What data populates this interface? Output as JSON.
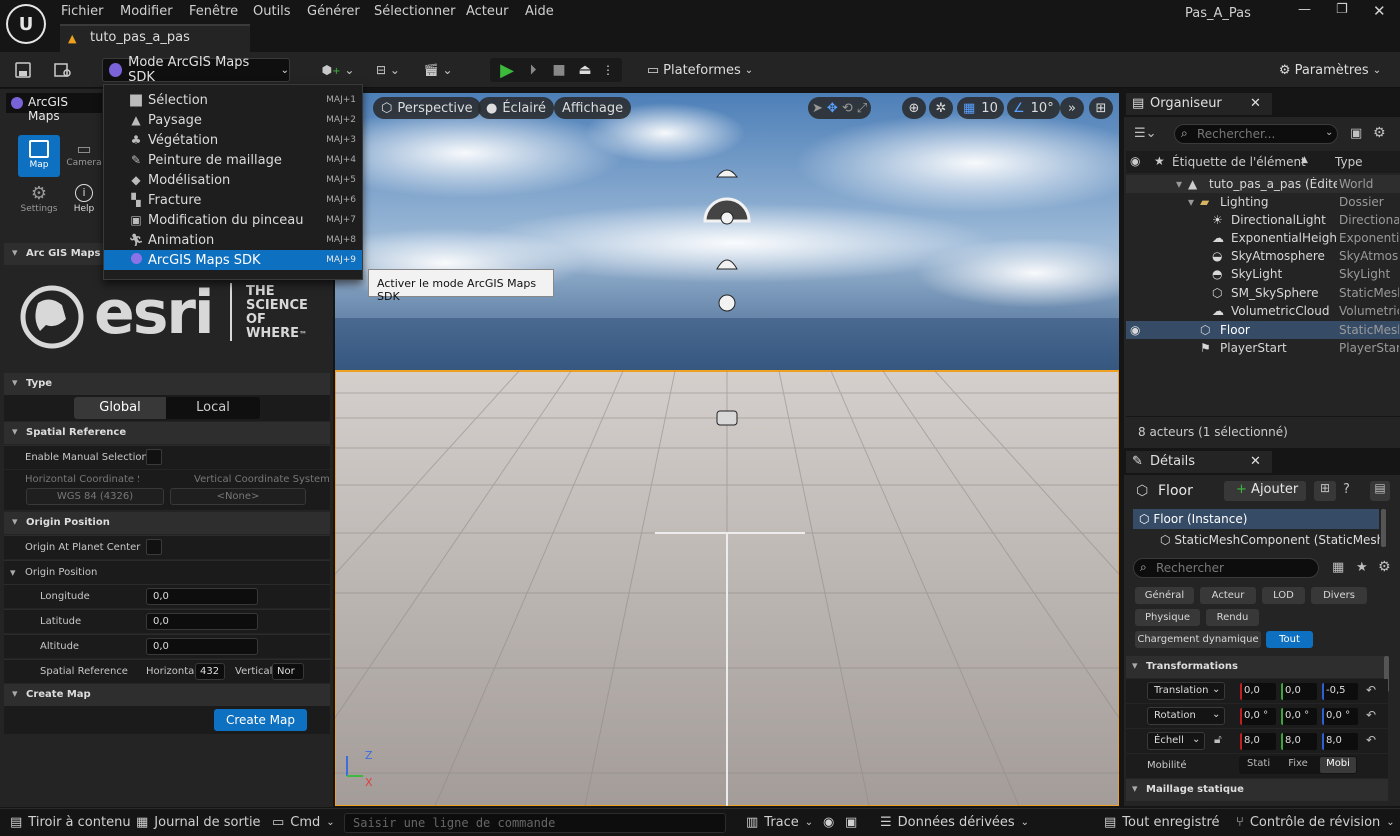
{
  "menubar": {
    "items": [
      "Fichier",
      "Modifier",
      "Fenêtre",
      "Outils",
      "Générer",
      "Sélectionner",
      "Acteur",
      "Aide"
    ],
    "project_name": "Pas_A_Pas"
  },
  "tab": {
    "label": "tuto_pas_a_pas"
  },
  "toolbar": {
    "mode_label": "Mode ArcGIS Maps SDK",
    "platforms_label": "Plateformes",
    "settings_label": "Paramètres"
  },
  "mode_menu": {
    "items": [
      {
        "label": "Sélection",
        "shortcut": "MAJ+1",
        "icon": "select-icon"
      },
      {
        "label": "Paysage",
        "shortcut": "MAJ+2",
        "icon": "landscape-icon"
      },
      {
        "label": "Végétation",
        "shortcut": "MAJ+3",
        "icon": "foliage-icon"
      },
      {
        "label": "Peinture de maillage",
        "shortcut": "MAJ+4",
        "icon": "mesh-paint-icon"
      },
      {
        "label": "Modélisation",
        "shortcut": "MAJ+5",
        "icon": "modeling-icon"
      },
      {
        "label": "Fracture",
        "shortcut": "MAJ+6",
        "icon": "fracture-icon"
      },
      {
        "label": "Modification du pinceau",
        "shortcut": "MAJ+7",
        "icon": "brush-icon"
      },
      {
        "label": "Animation",
        "shortcut": "MAJ+8",
        "icon": "animation-icon"
      },
      {
        "label": "ArcGIS Maps SDK",
        "shortcut": "MAJ+9",
        "icon": "arcgis-icon"
      }
    ],
    "selected_index": 8,
    "tooltip": "Activer le mode ArcGIS Maps SDK"
  },
  "left_panel": {
    "title": "ArcGIS Maps",
    "tools": [
      {
        "label": "Map",
        "icon": "map-icon"
      },
      {
        "label": "Camera",
        "icon": "camera-icon"
      },
      {
        "label": "Settings",
        "icon": "gear-icon"
      },
      {
        "label": "Help",
        "icon": "info-icon"
      }
    ],
    "section_title": "Arc GIS Maps SDK",
    "logo": {
      "word": "esri",
      "tagline_1": "THE",
      "tagline_2": "SCIENCE",
      "tagline_3": "OF",
      "tagline_4": "WHERE",
      "tm": "™"
    },
    "type_header": "Type",
    "type_options": [
      "Global",
      "Local"
    ],
    "type_selected": "Global",
    "spatial_reference_header": "Spatial Reference",
    "enable_manual_selection": "Enable Manual Selection",
    "horizontal_cs_label": "Horizontal Coordinate Syste",
    "vertical_cs_label": "Vertical Coordinate System",
    "horizontal_cs_value": "WGS 84 (4326)",
    "vertical_cs_value": "<None>",
    "origin_position_header": "Origin Position",
    "origin_at_planet_center": "Origin At Planet Center",
    "origin_position_sub": "Origin Position",
    "longitude_label": "Longitude",
    "longitude_value": "0,0",
    "latitude_label": "Latitude",
    "latitude_value": "0,0",
    "altitude_label": "Altitude",
    "altitude_value": "0,0",
    "spatial_ref_label": "Spatial Reference",
    "horizontal_label": "Horizontal",
    "horizontal_value": "432",
    "vertical_label": "Vertical",
    "vertical_value": "Nor",
    "create_map_header": "Create Map",
    "create_map_button": "Create Map"
  },
  "viewport": {
    "perspective": "Perspective",
    "lighting": "Éclairé",
    "show": "Affichage",
    "grid_snap": "10",
    "rot_snap": "10°",
    "axis_z": "Z",
    "axis_x": "X"
  },
  "outliner": {
    "tab": "Organiseur",
    "search_placeholder": "Rechercher...",
    "col_label": "Étiquette de l'élément",
    "col_type": "Type",
    "rows": [
      {
        "name": "tuto_pas_a_pas (Édite",
        "type": "World"
      },
      {
        "name": "Lighting",
        "type": "Dossier"
      },
      {
        "name": "DirectionalLight",
        "type": "Directiona"
      },
      {
        "name": "ExponentialHeight",
        "type": "Exponentia"
      },
      {
        "name": "SkyAtmosphere",
        "type": "SkyAtmos"
      },
      {
        "name": "SkyLight",
        "type": "SkyLight"
      },
      {
        "name": "SM_SkySphere",
        "type": "StaticMesh"
      },
      {
        "name": "VolumetricCloud",
        "type": "Volumetric"
      },
      {
        "name": "Floor",
        "type": "StaticMesh"
      },
      {
        "name": "PlayerStart",
        "type": "PlayerStar"
      }
    ],
    "status": "8 acteurs (1 sélectionné)"
  },
  "details": {
    "tab": "Détails",
    "object_name": "Floor",
    "add_button": "Ajouter",
    "instance": "Floor (Instance)",
    "component": "StaticMeshComponent (StaticMesh",
    "search_placeholder": "Rechercher",
    "categories": [
      "Général",
      "Acteur",
      "LOD",
      "Divers",
      "Physique",
      "Rendu",
      "Chargement dynamique",
      "Tout"
    ],
    "active_category": "Tout",
    "transforms_header": "Transformations",
    "translation_label": "Translation",
    "translation": [
      "0,0",
      "0,0",
      "-0,5"
    ],
    "rotation_label": "Rotation",
    "rotation": [
      "0,0 °",
      "0,0 °",
      "0,0 °"
    ],
    "scale_label": "Échell",
    "scale": [
      "8,0",
      "8,0",
      "8,0"
    ],
    "mobility_label": "Mobilité",
    "mobility_options": [
      "Stati",
      "Fixe",
      "Mobi"
    ],
    "mobility_selected": "Mobi",
    "static_mesh_header": "Maillage statique"
  },
  "statusbar": {
    "content_drawer": "Tiroir à contenu",
    "output_log": "Journal de sortie",
    "cmd": "Cmd",
    "cmd_placeholder": "Saisir une ligne de commande",
    "trace": "Trace",
    "derived_data": "Données dérivées",
    "all_saved": "Tout enregistré",
    "revision_control": "Contrôle de révision"
  },
  "colors": {
    "accent": "#0e70c0",
    "play_green": "#3cba3c",
    "selection_orange": "#f0a020"
  }
}
